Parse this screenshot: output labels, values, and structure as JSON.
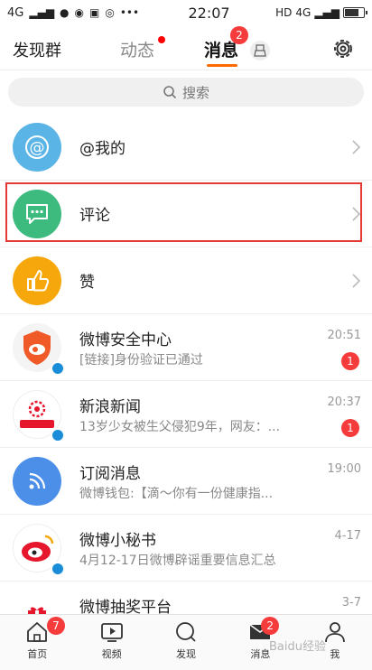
{
  "status_bar": {
    "network": "4G",
    "time": "22:07",
    "hd": "HD",
    "network_right": "4G"
  },
  "header": {
    "left_label": "发现群",
    "tab_dongtai": "动态",
    "tab_xiaoxi": "消息",
    "xiaoxi_badge": "2"
  },
  "search": {
    "placeholder": "搜索"
  },
  "rows": [
    {
      "title": "@我的"
    },
    {
      "title": "评论"
    },
    {
      "title": "赞"
    },
    {
      "title": "微博安全中心",
      "subtitle": "[链接]身份验证已通过",
      "time": "20:51",
      "badge": "1"
    },
    {
      "title": "新浪新闻",
      "subtitle": "13岁少女被生父侵犯9年，网友：...",
      "time": "20:37",
      "badge": "1"
    },
    {
      "title": "订阅消息",
      "subtitle": "微博钱包:【滴～你有一份健康指...",
      "time": "19:00"
    },
    {
      "title": "微博小秘书",
      "subtitle": "4月12-17日微博辟谣重要信息汇总",
      "time": "4-17"
    },
    {
      "title": "微博抽奖平台",
      "time": "3-7"
    }
  ],
  "tabbar": {
    "home": "首页",
    "home_badge": "7",
    "video": "视频",
    "discover": "发现",
    "messages": "消息",
    "messages_badge": "2",
    "me": "我"
  },
  "watermark": "Baidu经验",
  "colors": {
    "accent": "#ff6a00",
    "badge": "#f53b3b",
    "highlight": "#e53935"
  }
}
